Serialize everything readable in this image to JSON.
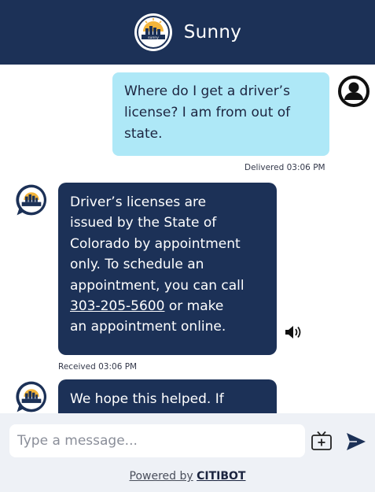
{
  "header": {
    "title": "Sunny",
    "logo_text": "sunny"
  },
  "messages": [
    {
      "sender": "user",
      "lines": [
        "Where do I get a driver’s",
        "license? I am from out of",
        "state."
      ],
      "status": "Delivered 03:06 PM"
    },
    {
      "sender": "bot",
      "lines_before_link": [
        "Driver’s licenses are",
        "issued by the State of",
        "Colorado by appointment",
        "only. To schedule an",
        "appointment, you can call"
      ],
      "link": "303-205-5600",
      "after_link": " or make",
      "lines_after": [
        "an appointment online."
      ],
      "status": "Received 03:06 PM"
    },
    {
      "sender": "bot",
      "lines": [
        "We hope this helped. If"
      ]
    }
  ],
  "composer": {
    "placeholder": "Type a message..."
  },
  "footer": {
    "powered_prefix": "Powered by",
    "brand": "CITIBOT"
  },
  "colors": {
    "header_bg": "#1c3157",
    "user_bubble": "#aee8f7",
    "bot_bubble": "#1c3157",
    "send_icon": "#1c3157"
  },
  "icons": {
    "user_avatar": "user-avatar-icon",
    "bot_avatar": "sunny-logo-icon",
    "speaker": "speaker-icon",
    "attach": "attach-media-icon",
    "send": "send-icon"
  }
}
